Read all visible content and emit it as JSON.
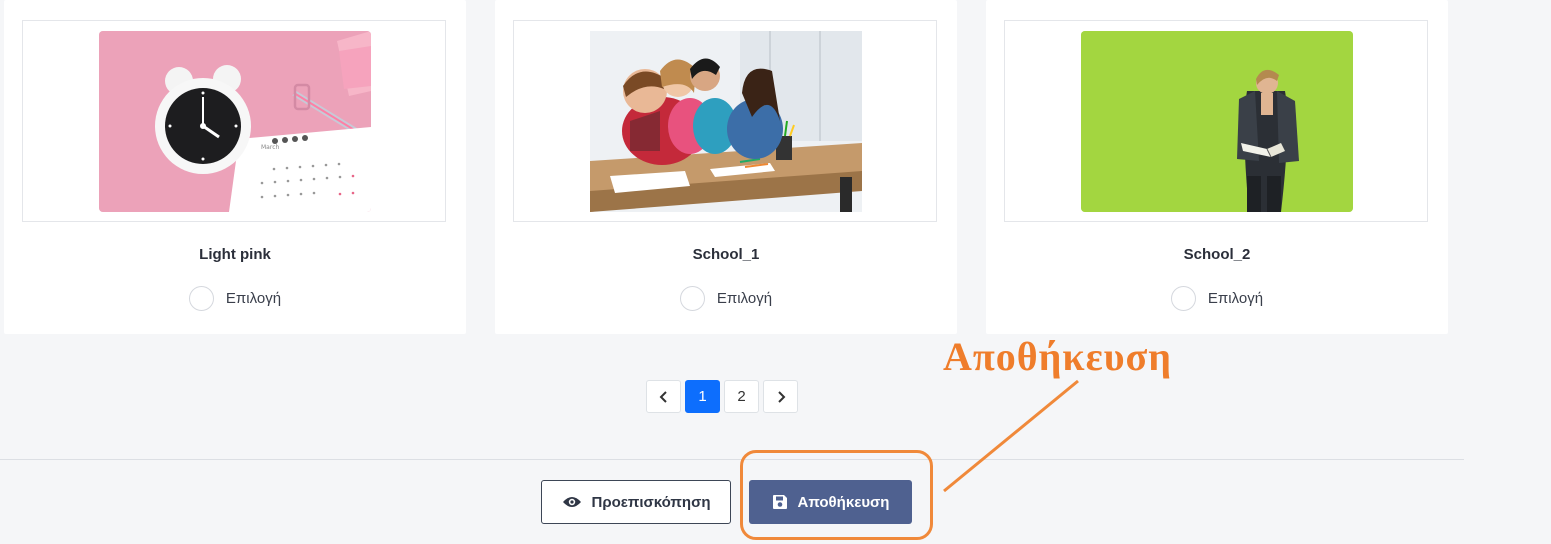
{
  "cards": [
    {
      "title": "Light pink",
      "option_label": "Επιλογή",
      "image": "pink-desk-alarm-clock-calendar-photo"
    },
    {
      "title": "School_1",
      "option_label": "Επιλογή",
      "image": "students-drawing-at-table-photo"
    },
    {
      "title": "School_2",
      "option_label": "Επιλογή",
      "image": "student-with-book-green-wall-photo"
    }
  ],
  "pagination": {
    "prev_icon": "chevron-left-icon",
    "pages": [
      "1",
      "2"
    ],
    "active_page": "1",
    "next_icon": "chevron-right-icon"
  },
  "actions": {
    "preview_label": "Προεπισκόπηση",
    "preview_icon": "eye-icon",
    "save_label": "Αποθήκευση",
    "save_icon": "floppy-disk-icon"
  },
  "annotation": {
    "text": "Αποθήκευση",
    "color": "#ef7d2b"
  },
  "colors": {
    "primary_page": "#0d6efd",
    "save_button": "#4f6190"
  }
}
